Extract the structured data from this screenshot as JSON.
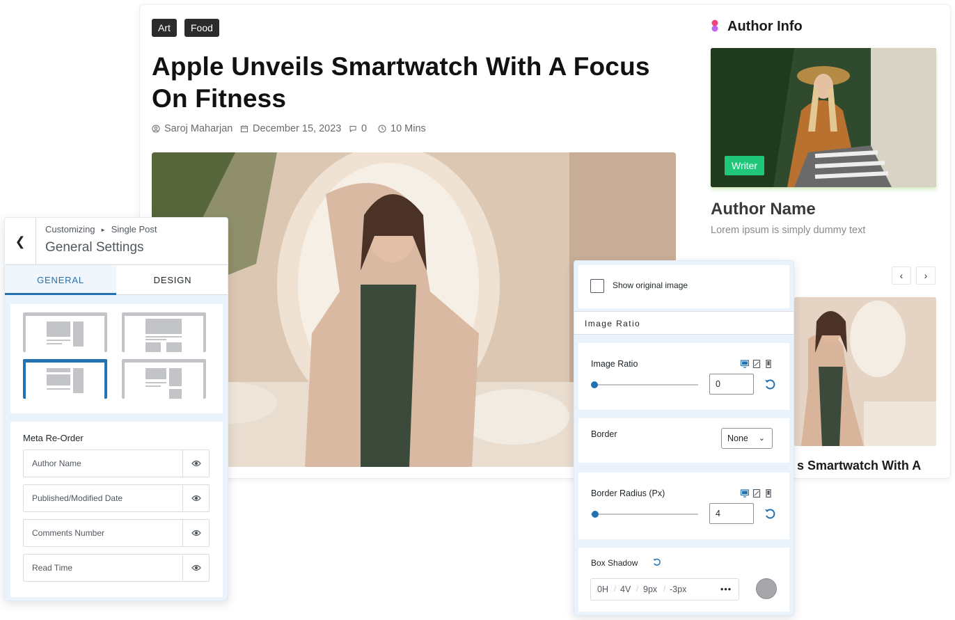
{
  "post": {
    "tags": [
      "Art",
      "Food"
    ],
    "title": "Apple Unveils Smartwatch With A Focus On Fitness",
    "author": "Saroj Maharjan",
    "date": "December 15, 2023",
    "comments": "0",
    "read_time": "10 Mins"
  },
  "sidebar": {
    "heading": "Author Info",
    "badge": "Writer",
    "author_name": "Author Name",
    "author_desc": "Lorem ipsum is simply dummy text",
    "prev_icon": "chevron-left-icon",
    "next_icon": "chevron-right-icon",
    "related_title": "s Smartwatch With A"
  },
  "left_panel": {
    "breadcrumb_root": "Customizing",
    "breadcrumb_section": "Single Post",
    "title": "General Settings",
    "tabs": [
      "GENERAL",
      "DESIGN"
    ],
    "active_tab": "GENERAL",
    "selected_layout": 3,
    "meta_heading": "Meta Re-Order",
    "meta_items": [
      "Author Name",
      "Published/Modified Date",
      "Comments Number",
      "Read Time"
    ]
  },
  "right_panel": {
    "show_original_label": "Show original image",
    "show_original_checked": false,
    "section_heading": "Image Ratio",
    "image_ratio_label": "Image Ratio",
    "image_ratio_value": "0",
    "border_label": "Border",
    "border_value": "None",
    "border_radius_label": "Border Radius (Px)",
    "border_radius_value": "4",
    "box_shadow_label": "Box Shadow",
    "shadow": {
      "h": "0H",
      "v": "4V",
      "blur": "9px",
      "spread": "-3px",
      "more": "•••"
    },
    "shadow_color": "#a7a7ab"
  },
  "colors": {
    "accent": "#2271b1",
    "tag_bg": "#2b2b2b",
    "badge_bg": "#20c77a"
  }
}
